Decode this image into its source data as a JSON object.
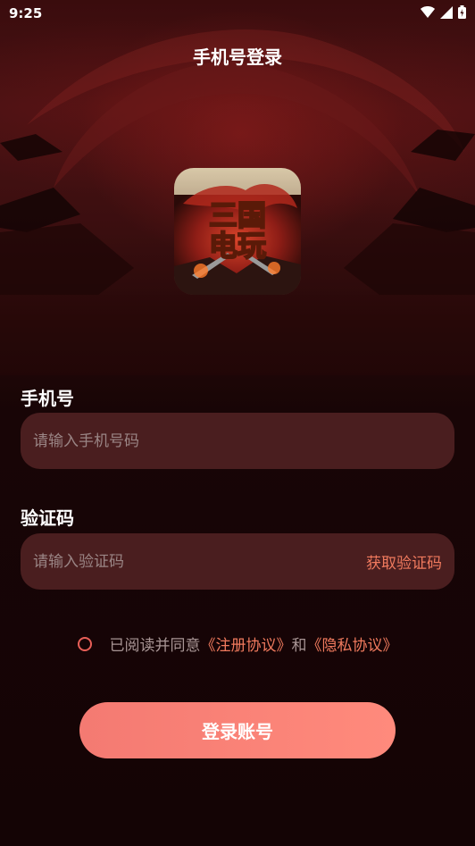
{
  "status_bar": {
    "time": "9:25"
  },
  "header": {
    "title": "手机号登录"
  },
  "logo": {
    "text_line1": "三国",
    "text_line2": "电玩"
  },
  "phone": {
    "label": "手机号",
    "placeholder": "请输入手机号码",
    "value": ""
  },
  "code": {
    "label": "验证码",
    "placeholder": "请输入验证码",
    "value": "",
    "get_code_label": "获取验证码"
  },
  "agreement": {
    "checked": false,
    "prefix": "已阅读并同意",
    "register_link": "《注册协议》",
    "conjunction": "和",
    "privacy_link": "《隐私协议》"
  },
  "login_button": {
    "label": "登录账号"
  },
  "colors": {
    "accent": "#f07a5e",
    "button_start": "#f47a72",
    "button_end": "#ff8a7c",
    "input_bg": "#4a1e1f",
    "page_bg": "#1a0607"
  }
}
